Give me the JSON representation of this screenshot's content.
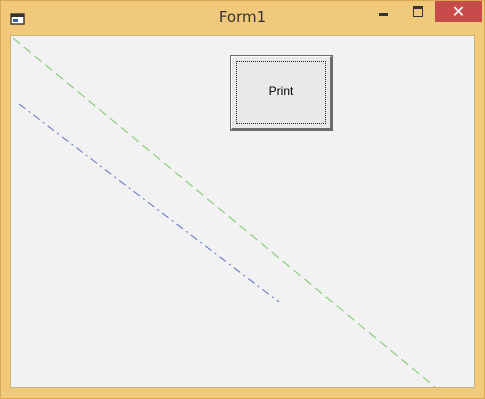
{
  "window": {
    "title": "Form1",
    "close_glyph": "✕",
    "icons": {
      "app": "form-app-icon",
      "minimize": "minimize-icon",
      "maximize": "maximize-icon",
      "close": "close-icon"
    },
    "colors": {
      "frame": "#f1c97a",
      "close_button": "#c74b4b",
      "client_background": "#f2f2f2"
    }
  },
  "form": {
    "print_button_label": "Print",
    "lines": [
      {
        "name": "green-dashed-line",
        "color": "#7cc66a",
        "style": "dash"
      },
      {
        "name": "blue-dash-dot-line",
        "color": "#5b6fc9",
        "style": "dash-dot"
      }
    ]
  }
}
